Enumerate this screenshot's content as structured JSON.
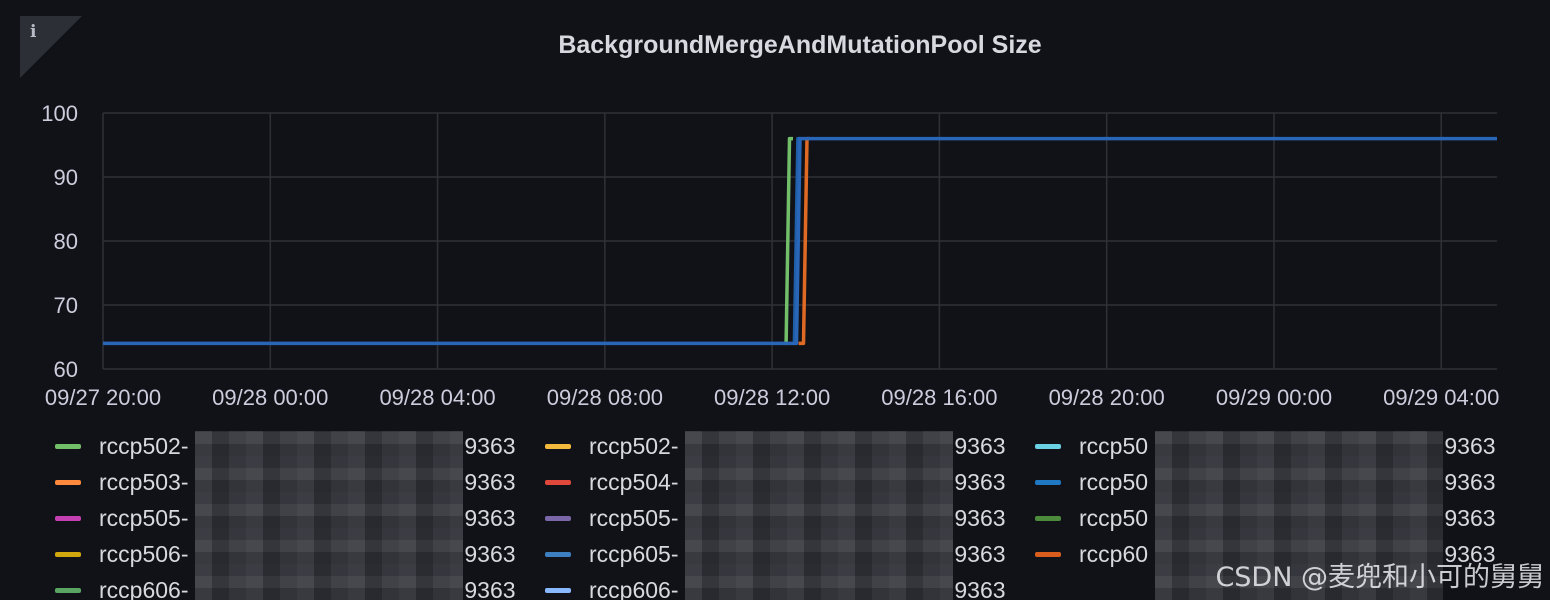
{
  "panel": {
    "info_glyph": "i",
    "info_icon": "info-icon"
  },
  "colors": {
    "background": "#111217",
    "grid": "#2f3137",
    "text": "#ccccdc"
  },
  "chart_data": {
    "type": "line",
    "title": "BackgroundMergeAndMutationPool Size",
    "xlabel": "",
    "ylabel": "",
    "x_type": "datetime",
    "xlim": [
      "09/27 20:00",
      "09/29 05:20"
    ],
    "ylim": [
      60,
      100
    ],
    "y_ticks": [
      60,
      70,
      80,
      90,
      100
    ],
    "x_ticks": [
      "09/27 20:00",
      "09/28 00:00",
      "09/28 04:00",
      "09/28 08:00",
      "09/28 12:00",
      "09/28 16:00",
      "09/28 20:00",
      "09/29 00:00",
      "09/29 04:00"
    ],
    "grid": true,
    "legend_position": "bottom",
    "series": [
      {
        "color": "#2a66b8",
        "points": [
          [
            "09/27 20:00",
            64
          ],
          [
            "09/28 12:35",
            64
          ],
          [
            "09/28 12:40",
            96
          ],
          [
            "09/29 05:20",
            96
          ]
        ]
      },
      {
        "color": "#73bf69",
        "points": [
          [
            "09/28 12:18",
            64
          ],
          [
            "09/28 12:20",
            64
          ],
          [
            "09/28 12:25",
            96
          ],
          [
            "09/28 12:30",
            96
          ]
        ]
      },
      {
        "color": "#e06a23",
        "points": [
          [
            "09/28 12:38",
            64
          ],
          [
            "09/28 12:45",
            64
          ],
          [
            "09/28 12:50",
            96
          ],
          [
            "09/28 12:53",
            96
          ]
        ]
      },
      {
        "color": "#1f5fa8",
        "points": [
          [
            "09/28 12:30",
            64
          ],
          [
            "09/28 12:32",
            64
          ],
          [
            "09/28 12:37",
            96
          ],
          [
            "09/28 12:40",
            96
          ]
        ]
      }
    ]
  },
  "legend": {
    "rows": [
      [
        {
          "prefix": "rccp502-",
          "suffix": ":9363",
          "color": "#73bf69"
        },
        {
          "prefix": "rccp502-",
          "suffix": ":9363",
          "color": "#f2b93c"
        },
        {
          "prefix": "rccp50",
          "suffix": ":9363",
          "color": "#6ad0e4"
        }
      ],
      [
        {
          "prefix": "rccp503-",
          "suffix": ":9363",
          "color": "#ff8a3d"
        },
        {
          "prefix": "rccp504-",
          "suffix": ":9363",
          "color": "#e0483b"
        },
        {
          "prefix": "rccp50",
          "suffix": ":9363",
          "color": "#1f78c1"
        }
      ],
      [
        {
          "prefix": "rccp505-",
          "suffix": ":9363",
          "color": "#c33fb2"
        },
        {
          "prefix": "rccp505-",
          "suffix": ":9363",
          "color": "#7b66a8"
        },
        {
          "prefix": "rccp50",
          "suffix": ":9363",
          "color": "#4c8a3c"
        }
      ],
      [
        {
          "prefix": "rccp506-",
          "suffix": ":9363",
          "color": "#d2a80f"
        },
        {
          "prefix": "rccp605-",
          "suffix": ":9363",
          "color": "#3e7fc1"
        },
        {
          "prefix": "rccp60",
          "suffix": ":9363",
          "color": "#d95d1c"
        }
      ],
      [
        {
          "prefix": "rccp606-",
          "suffix": ":9363",
          "color": "#5aa564"
        },
        {
          "prefix": "rccp606-",
          "suffix": ":9363",
          "color": "#8ab8ff"
        }
      ]
    ]
  },
  "watermark": "CSDN @麦兜和小可的舅舅"
}
